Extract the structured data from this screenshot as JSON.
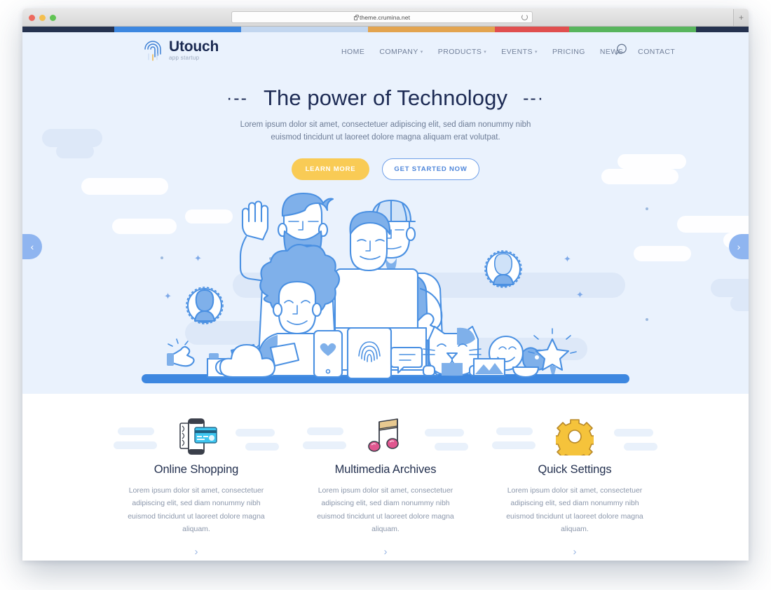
{
  "browser": {
    "url": "theme.crumina.net",
    "lock_icon": "lock-icon",
    "reload_icon": "reload-icon",
    "new_tab_label": "+",
    "traffic_lights": [
      "close",
      "minimize",
      "zoom"
    ]
  },
  "stripe": {
    "colors": [
      "#25324f",
      "#3d87e0",
      "#c2d6ef",
      "#e3a44f",
      "#e04f4f",
      "#58b55d",
      "#25324f"
    ],
    "widths": [
      156,
      216,
      216,
      216,
      126,
      216,
      90
    ]
  },
  "header": {
    "logo": {
      "name": "Utouch",
      "tagline": "app startup",
      "icon": "fingerprint-icon"
    },
    "nav": [
      {
        "label": "HOME",
        "has_dropdown": false
      },
      {
        "label": "COMPANY",
        "has_dropdown": true
      },
      {
        "label": "PRODUCTS",
        "has_dropdown": true
      },
      {
        "label": "EVENTS",
        "has_dropdown": true
      },
      {
        "label": "PRICING",
        "has_dropdown": false
      },
      {
        "label": "NEWS",
        "has_dropdown": false
      },
      {
        "label": "CONTACT",
        "has_dropdown": false
      }
    ],
    "search_icon": "search-icon",
    "caret_glyph": "▾"
  },
  "hero": {
    "dash_left": "·--",
    "dash_right": "--·",
    "title": "The power of Technology",
    "subtitle": "Lorem ipsum dolor sit amet, consectetuer adipiscing elit, sed diam nonummy nibh euismod tincidunt ut laoreet dolore magna aliquam erat volutpat.",
    "primary_button": "LEARN MORE",
    "outline_button": "GET STARTED NOW",
    "prev_arrow": "‹",
    "next_arrow": "›",
    "background_color": "#eaf2fd",
    "accent_yellow": "#f9cb55",
    "accent_blue": "#4e86da",
    "illustration": "team-technology-illustration"
  },
  "features": [
    {
      "icon": "mobile-payment-icon",
      "title": "Online Shopping",
      "text": "Lorem ipsum dolor sit amet, consectetuer adipiscing elit, sed diam nonummy nibh euismod tincidunt ut laoreet dolore magna aliquam.",
      "arrow": "›"
    },
    {
      "icon": "music-note-icon",
      "title": "Multimedia Archives",
      "text": "Lorem ipsum dolor sit amet, consectetuer adipiscing elit, sed diam nonummy nibh euismod tincidunt ut laoreet dolore magna aliquam.",
      "arrow": "›"
    },
    {
      "icon": "gear-icon",
      "title": "Quick Settings",
      "text": "Lorem ipsum dolor sit amet, consectetuer adipiscing elit, sed diam nonummy nibh euismod tincidunt ut laoreet dolore magna aliquam.",
      "arrow": "›"
    }
  ]
}
